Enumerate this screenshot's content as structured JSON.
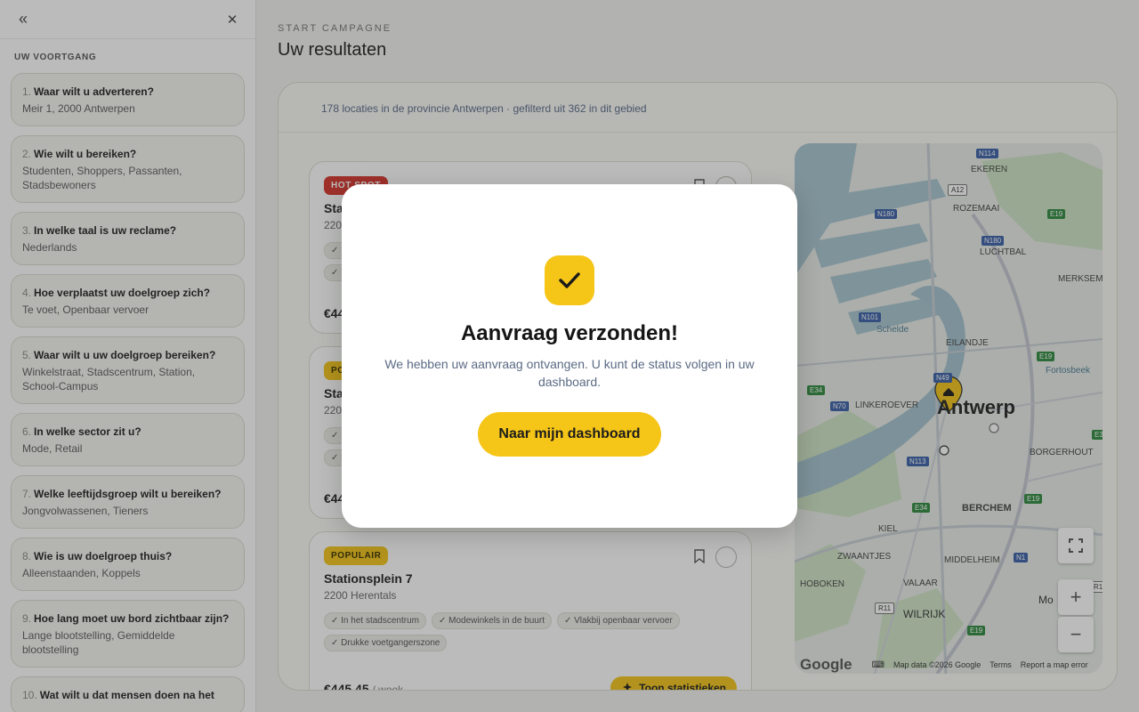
{
  "sidebar": {
    "collapse_icon": "«",
    "close_icon": "✕",
    "heading": "UW VOORTGANG",
    "steps": [
      {
        "num": "1.",
        "question": "Waar wilt u adverteren?",
        "answer": "Meir 1, 2000 Antwerpen"
      },
      {
        "num": "2.",
        "question": "Wie wilt u bereiken?",
        "answer": "Studenten, Shoppers, Passanten, Stadsbewoners"
      },
      {
        "num": "3.",
        "question": "In welke taal is uw reclame?",
        "answer": "Nederlands"
      },
      {
        "num": "4.",
        "question": "Hoe verplaatst uw doelgroep zich?",
        "answer": "Te voet, Openbaar vervoer"
      },
      {
        "num": "5.",
        "question": "Waar wilt u uw doelgroep bereiken?",
        "answer": "Winkelstraat, Stadscentrum, Station, School-Campus"
      },
      {
        "num": "6.",
        "question": "In welke sector zit u?",
        "answer": "Mode, Retail"
      },
      {
        "num": "7.",
        "question": "Welke leeftijdsgroep wilt u bereiken?",
        "answer": "Jongvolwassenen, Tieners"
      },
      {
        "num": "8.",
        "question": "Wie is uw doelgroep thuis?",
        "answer": "Alleenstaanden, Koppels"
      },
      {
        "num": "9.",
        "question": "Hoe lang moet uw bord zichtbaar zijn?",
        "answer": "Lange blootstelling, Gemiddelde blootstelling"
      },
      {
        "num": "10.",
        "question": "Wat wilt u dat mensen doen na het",
        "answer": ""
      }
    ]
  },
  "main": {
    "eyebrow": "START CAMPAGNE",
    "title": "Uw resultaten",
    "results_count": "178 locaties in de provincie Antwerpen · gefilterd uit 362 in dit gebied"
  },
  "cards": [
    {
      "badge": "HOT SPOT",
      "title": "Sta",
      "city": "2200",
      "tags": [
        "✓ I",
        "✓ D"
      ],
      "price": "€44",
      "unit": ""
    },
    {
      "badge": "PO",
      "title": "Sta",
      "city": "220",
      "tags": [
        "✓ I",
        "✓ D"
      ],
      "price": "€44",
      "unit": ""
    },
    {
      "badge": "POPULAIR",
      "title": "Stationsplein 7",
      "city": "2200 Herentals",
      "tags": [
        "✓ In het stadscentrum",
        "✓ Modewinkels in de buurt",
        "✓ Vlakbij openbaar vervoer",
        "✓ Drukke voetgangerszone"
      ],
      "price": "€445.45",
      "unit": "/ week",
      "stats_label": "Toon statistieken"
    }
  ],
  "map": {
    "city_label": "Antwerp",
    "labels": [
      "EKEREN",
      "ROZEMAAI",
      "LUCHTBAL",
      "MERKSEM",
      "EILANDJE",
      "Schelde",
      "Fortosbeek",
      "LINKEROEVER",
      "BORGERHOUT",
      "BERCHEM",
      "KIEL",
      "ZWAANTJES",
      "MIDDELHEIM",
      "HOBOKEN",
      "VALAAR",
      "WILRIJK",
      "Mo"
    ],
    "shields": [
      "N114",
      "A12",
      "N180",
      "E19",
      "N180",
      "N101",
      "N49",
      "E19",
      "E34",
      "N70",
      "N113",
      "E34",
      "E19",
      "N1",
      "R11",
      "E19",
      "R1",
      "E3"
    ],
    "google": "Google",
    "map_data": "Map data ©2026 Google",
    "terms": "Terms",
    "report": "Report a map error",
    "zoom_in": "+",
    "zoom_out": "−"
  },
  "modal": {
    "title": "Aanvraag verzonden!",
    "message": "We hebben uw aanvraag ontvangen. U kunt de status volgen in uw dashboard.",
    "button": "Naar mijn dashboard"
  },
  "colors": {
    "accent": "#f5c518",
    "hot": "#d6332b",
    "water": "#9fbfcc"
  }
}
